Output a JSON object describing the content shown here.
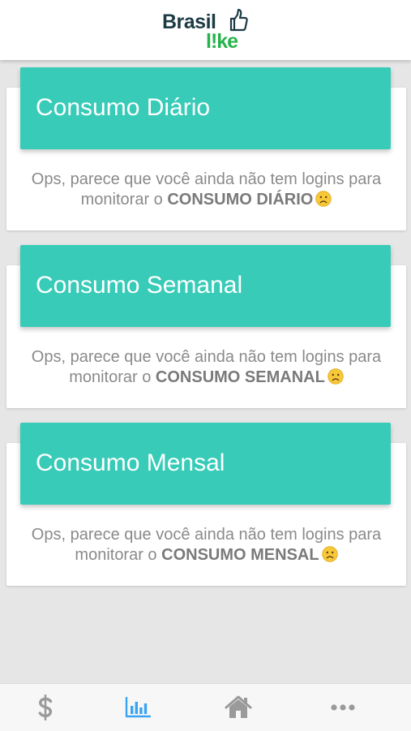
{
  "header": {
    "logo": {
      "brand_word": "Brasil",
      "brand_suffix": "l!ke",
      "icon": "thumbs-up-icon",
      "colors": {
        "brasil": "#1d3b45",
        "like": "#27b34b"
      }
    }
  },
  "cards": [
    {
      "title": "Consumo Diário",
      "message_prefix": "Ops, parece que você ainda não tem logins para monitorar o",
      "message_strong": "CONSUMO DIÁRIO",
      "icon": "sad-face-icon"
    },
    {
      "title": "Consumo Semanal",
      "message_prefix": "Ops, parece que você ainda não tem logins para monitorar o",
      "message_strong": "CONSUMO SEMANAL",
      "icon": "sad-face-icon"
    },
    {
      "title": "Consumo Mensal",
      "message_prefix": "Ops, parece que você ainda não tem logins para monitorar o",
      "message_strong": "CONSUMO MENSAL",
      "icon": "sad-face-icon"
    }
  ],
  "tabbar": {
    "tabs": [
      {
        "icon": "dollar-icon",
        "active": false
      },
      {
        "icon": "bar-chart-icon",
        "active": true
      },
      {
        "icon": "home-icon",
        "active": false
      },
      {
        "icon": "more-icon",
        "active": false
      }
    ]
  },
  "colors": {
    "accent": "#37cbb8",
    "tab_active": "#3aa4f2",
    "tab_inactive": "#9a9a9a",
    "background": "#e6e6e6"
  }
}
